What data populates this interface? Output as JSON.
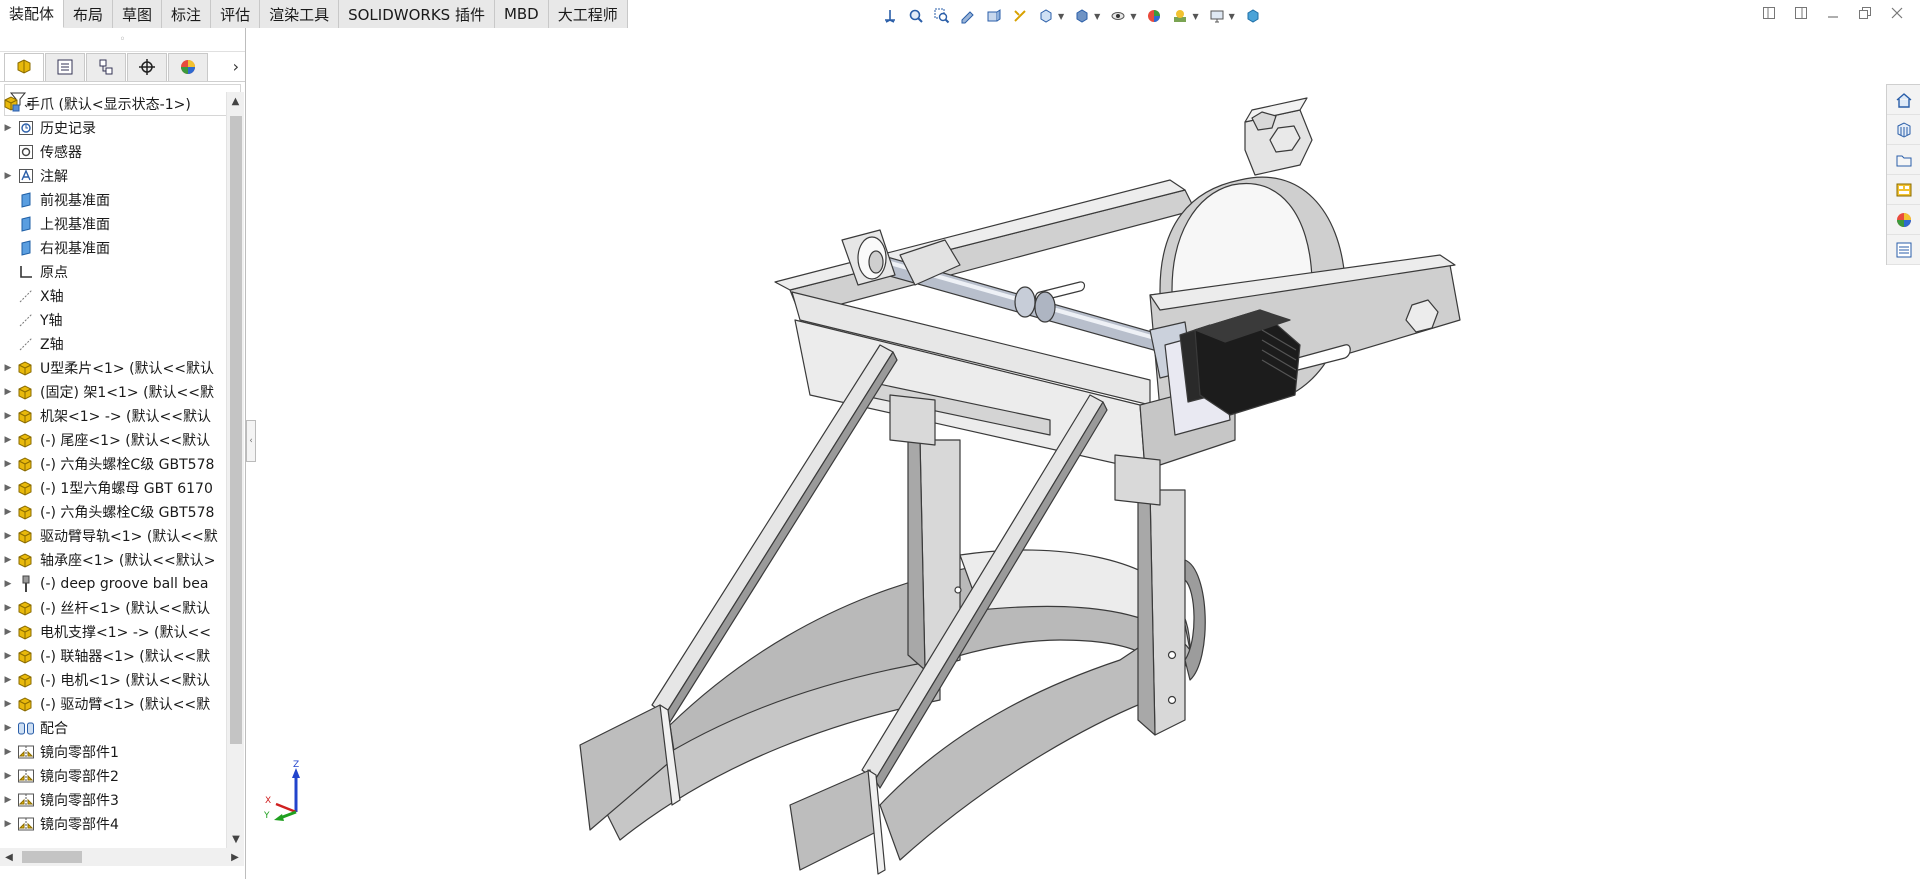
{
  "command_tabs": [
    {
      "label": "装配体",
      "active": true
    },
    {
      "label": "布局",
      "active": false
    },
    {
      "label": "草图",
      "active": false
    },
    {
      "label": "标注",
      "active": false
    },
    {
      "label": "评估",
      "active": false
    },
    {
      "label": "渲染工具",
      "active": false
    },
    {
      "label": "SOLIDWORKS 插件",
      "active": false
    },
    {
      "label": "MBD",
      "active": false
    },
    {
      "label": "大工程师",
      "active": false
    }
  ],
  "feature_tree": {
    "root_label": "手爪 (默认<显示状态-1>)",
    "items": [
      {
        "label": "历史记录",
        "icon": "history-icon",
        "expandable": true
      },
      {
        "label": "传感器",
        "icon": "sensor-icon",
        "expandable": false
      },
      {
        "label": "注解",
        "icon": "annotation-icon",
        "expandable": true
      },
      {
        "label": "前视基准面",
        "icon": "plane-icon",
        "expandable": false
      },
      {
        "label": "上视基准面",
        "icon": "plane-icon",
        "expandable": false
      },
      {
        "label": "右视基准面",
        "icon": "plane-icon",
        "expandable": false
      },
      {
        "label": "原点",
        "icon": "origin-icon",
        "expandable": false
      },
      {
        "label": "X轴",
        "icon": "axis-icon",
        "expandable": false
      },
      {
        "label": "Y轴",
        "icon": "axis-icon",
        "expandable": false
      },
      {
        "label": "Z轴",
        "icon": "axis-icon",
        "expandable": false
      },
      {
        "label": "U型柔片<1> (默认<<默认",
        "icon": "part-icon",
        "expandable": true
      },
      {
        "label": "(固定) 架1<1> (默认<<默",
        "icon": "part-icon",
        "expandable": true
      },
      {
        "label": "机架<1> -> (默认<<默认",
        "icon": "part-icon",
        "expandable": true
      },
      {
        "label": "(-) 尾座<1> (默认<<默认",
        "icon": "part-icon",
        "expandable": true
      },
      {
        "label": "(-) 六角头螺栓C级 GBT578",
        "icon": "part-icon",
        "expandable": true
      },
      {
        "label": "(-) 1型六角螺母 GBT 6170",
        "icon": "part-icon",
        "expandable": true
      },
      {
        "label": "(-) 六角头螺栓C级 GBT578",
        "icon": "part-icon",
        "expandable": true
      },
      {
        "label": "驱动臂导轨<1> (默认<<默",
        "icon": "part-icon",
        "expandable": true
      },
      {
        "label": "轴承座<1> (默认<<默认>",
        "icon": "part-icon",
        "expandable": true
      },
      {
        "label": "(-) deep groove ball bea",
        "icon": "toolbox-part-icon",
        "expandable": true
      },
      {
        "label": "(-) 丝杆<1> (默认<<默认",
        "icon": "part-icon",
        "expandable": true
      },
      {
        "label": "电机支撑<1> -> (默认<<",
        "icon": "part-icon",
        "expandable": true
      },
      {
        "label": "(-) 联轴器<1> (默认<<默",
        "icon": "part-icon",
        "expandable": true
      },
      {
        "label": "(-) 电机<1> (默认<<默认",
        "icon": "part-icon",
        "expandable": true
      },
      {
        "label": "(-) 驱动臂<1> (默认<<默",
        "icon": "part-icon",
        "expandable": true
      },
      {
        "label": "配合",
        "icon": "mates-icon",
        "expandable": true
      },
      {
        "label": "镜向零部件1",
        "icon": "mirror-component-icon",
        "expandable": true
      },
      {
        "label": "镜向零部件2",
        "icon": "mirror-component-icon",
        "expandable": true
      },
      {
        "label": "镜向零部件3",
        "icon": "mirror-component-icon",
        "expandable": true
      },
      {
        "label": "镜向零部件4",
        "icon": "mirror-component-icon",
        "expandable": true
      }
    ]
  },
  "triad": {
    "x": "X",
    "y": "Y",
    "z": "Z"
  },
  "colors": {
    "part_gray": "#d8d8d8",
    "part_dark": "#9a9a9a",
    "part_light": "#f4f4f4",
    "motor_black": "#1c1c1c",
    "part_icon_yellow": "#e8b90c",
    "accent_blue": "#2a6fc9"
  }
}
